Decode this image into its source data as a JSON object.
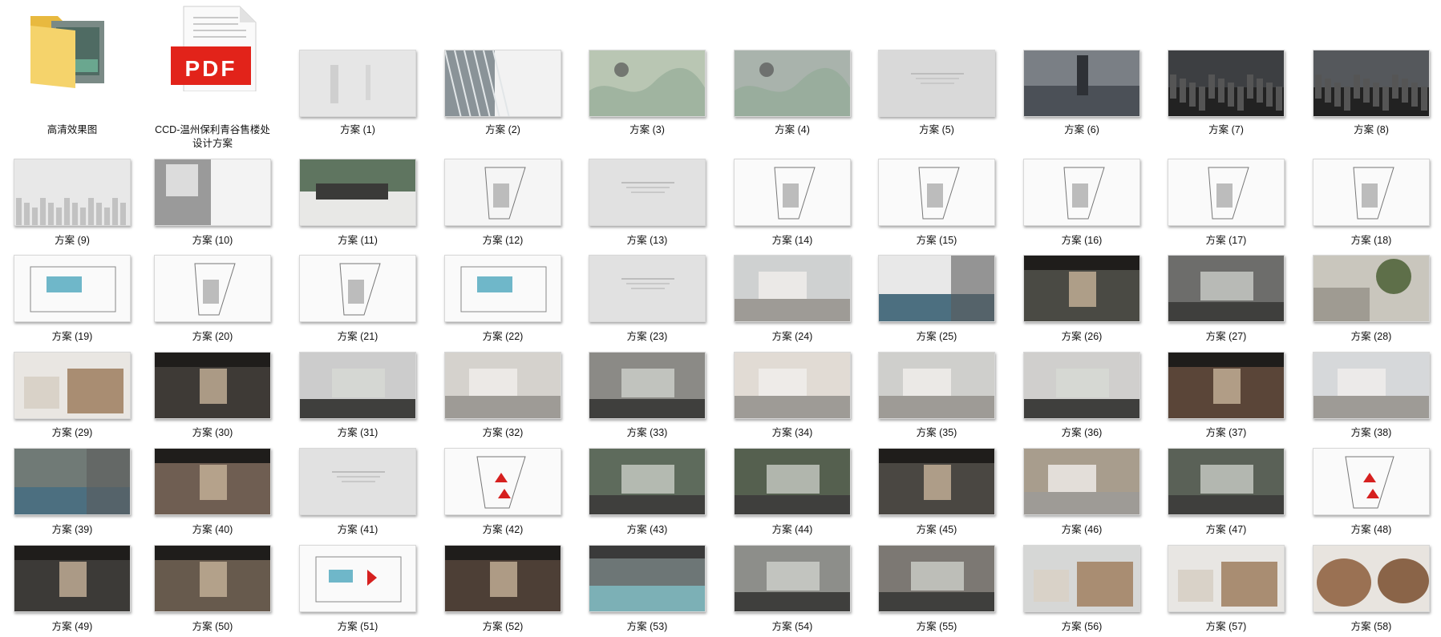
{
  "items": [
    {
      "label": "高清效果图",
      "kind": "folder",
      "thumb": "folder-icon"
    },
    {
      "label": "CCD-温州保利青谷售楼处设计方案",
      "kind": "pdf",
      "thumb": "pdf-icon",
      "badge": "PDF"
    },
    {
      "label": "方案 (1)",
      "thumb": {
        "bg": "#e6e6e6",
        "theme": "text-light"
      }
    },
    {
      "label": "方案 (2)",
      "thumb": {
        "bg": "#f2f2f2",
        "theme": "skylight"
      }
    },
    {
      "label": "方案 (3)",
      "thumb": {
        "bg": "#b9c6b3",
        "theme": "map"
      }
    },
    {
      "label": "方案 (4)",
      "thumb": {
        "bg": "#a9b3ac",
        "theme": "map"
      }
    },
    {
      "label": "方案 (5)",
      "thumb": {
        "bg": "#d9d9d9",
        "theme": "text-gray"
      }
    },
    {
      "label": "方案 (6)",
      "thumb": {
        "bg": "#7a7f85",
        "theme": "city-right"
      }
    },
    {
      "label": "方案 (7)",
      "thumb": {
        "bg": "#3d3f42",
        "theme": "city-dark"
      }
    },
    {
      "label": "方案 (8)",
      "thumb": {
        "bg": "#55585c",
        "theme": "city-dark"
      }
    },
    {
      "label": "方案 (9)",
      "thumb": {
        "bg": "#e8e8e8",
        "theme": "city-light"
      }
    },
    {
      "label": "方案 (10)",
      "thumb": {
        "bg": "#f3f3f3",
        "theme": "left-gray"
      }
    },
    {
      "label": "方案 (11)",
      "thumb": {
        "bg": "#5f7560",
        "theme": "landscape"
      }
    },
    {
      "label": "方案 (12)",
      "thumb": {
        "bg": "#f5f5f5",
        "theme": "plan-white"
      }
    },
    {
      "label": "方案 (13)",
      "thumb": {
        "bg": "#e1e1e1",
        "theme": "text-gray"
      }
    },
    {
      "label": "方案 (14)",
      "thumb": {
        "bg": "#fafafa",
        "theme": "plan-white"
      }
    },
    {
      "label": "方案 (15)",
      "thumb": {
        "bg": "#fafafa",
        "theme": "plan-white"
      }
    },
    {
      "label": "方案 (16)",
      "thumb": {
        "bg": "#fafafa",
        "theme": "plan-white"
      }
    },
    {
      "label": "方案 (17)",
      "thumb": {
        "bg": "#fafafa",
        "theme": "plan-white"
      }
    },
    {
      "label": "方案 (18)",
      "thumb": {
        "bg": "#fafafa",
        "theme": "plan-white"
      }
    },
    {
      "label": "方案 (19)",
      "thumb": {
        "bg": "#fafafa",
        "theme": "plan-pool"
      }
    },
    {
      "label": "方案 (20)",
      "thumb": {
        "bg": "#fafafa",
        "theme": "plan-white"
      }
    },
    {
      "label": "方案 (21)",
      "thumb": {
        "bg": "#fafafa",
        "theme": "plan-white"
      }
    },
    {
      "label": "方案 (22)",
      "thumb": {
        "bg": "#fafafa",
        "theme": "plan-pool"
      }
    },
    {
      "label": "方案 (23)",
      "thumb": {
        "bg": "#e1e1e1",
        "theme": "text-gray"
      }
    },
    {
      "label": "方案 (24)",
      "thumb": {
        "bg": "#cfd1d1",
        "theme": "interior-light"
      }
    },
    {
      "label": "方案 (25)",
      "thumb": {
        "bg": "#e8e8e8",
        "theme": "water"
      }
    },
    {
      "label": "方案 (26)",
      "thumb": {
        "bg": "#4a4a44",
        "theme": "interior-dark"
      }
    },
    {
      "label": "方案 (27)",
      "thumb": {
        "bg": "#6d6d6b",
        "theme": "interior-mid"
      }
    },
    {
      "label": "方案 (28)",
      "thumb": {
        "bg": "#c9c6bd",
        "theme": "tree"
      }
    },
    {
      "label": "方案 (29)",
      "thumb": {
        "bg": "#e9e6e2",
        "theme": "material"
      }
    },
    {
      "label": "方案 (30)",
      "thumb": {
        "bg": "#3e3a36",
        "theme": "interior-dark"
      }
    },
    {
      "label": "方案 (31)",
      "thumb": {
        "bg": "#cccccc",
        "theme": "interior-mid"
      }
    },
    {
      "label": "方案 (32)",
      "thumb": {
        "bg": "#d5d2cd",
        "theme": "interior-light"
      }
    },
    {
      "label": "方案 (33)",
      "thumb": {
        "bg": "#8b8a86",
        "theme": "interior-mid"
      }
    },
    {
      "label": "方案 (34)",
      "thumb": {
        "bg": "#e1dbd4",
        "theme": "interior-light"
      }
    },
    {
      "label": "方案 (35)",
      "thumb": {
        "bg": "#cfcfcc",
        "theme": "interior-light"
      }
    },
    {
      "label": "方案 (36)",
      "thumb": {
        "bg": "#d0cfcd",
        "theme": "interior-mid"
      }
    },
    {
      "label": "方案 (37)",
      "thumb": {
        "bg": "#5a4538",
        "theme": "interior-dark"
      }
    },
    {
      "label": "方案 (38)",
      "thumb": {
        "bg": "#d6d8da",
        "theme": "interior-light"
      }
    },
    {
      "label": "方案 (39)",
      "thumb": {
        "bg": "#707a76",
        "theme": "water"
      }
    },
    {
      "label": "方案 (40)",
      "thumb": {
        "bg": "#6f5e52",
        "theme": "interior-dark"
      }
    },
    {
      "label": "方案 (41)",
      "thumb": {
        "bg": "#e1e1e1",
        "theme": "text-gray"
      }
    },
    {
      "label": "方案 (42)",
      "thumb": {
        "bg": "#fafafa",
        "theme": "plan-red"
      }
    },
    {
      "label": "方案 (43)",
      "thumb": {
        "bg": "#5e6b5c",
        "theme": "interior-mid"
      }
    },
    {
      "label": "方案 (44)",
      "thumb": {
        "bg": "#55604f",
        "theme": "interior-mid"
      }
    },
    {
      "label": "方案 (45)",
      "thumb": {
        "bg": "#4a4742",
        "theme": "interior-dark"
      }
    },
    {
      "label": "方案 (46)",
      "thumb": {
        "bg": "#a89d8d",
        "theme": "interior-light"
      }
    },
    {
      "label": "方案 (47)",
      "thumb": {
        "bg": "#5a6157",
        "theme": "interior-mid"
      }
    },
    {
      "label": "方案 (48)",
      "thumb": {
        "bg": "#fafafa",
        "theme": "plan-red"
      }
    },
    {
      "label": "方案 (49)",
      "thumb": {
        "bg": "#3c3a37",
        "theme": "interior-dark"
      }
    },
    {
      "label": "方案 (50)",
      "thumb": {
        "bg": "#675a4d",
        "theme": "interior-dark"
      }
    },
    {
      "label": "方案 (51)",
      "thumb": {
        "bg": "#fafafa",
        "theme": "plan-pool-red"
      }
    },
    {
      "label": "方案 (52)",
      "thumb": {
        "bg": "#4d3f36",
        "theme": "interior-dark"
      }
    },
    {
      "label": "方案 (53)",
      "thumb": {
        "bg": "#6d7676",
        "theme": "pool-interior"
      }
    },
    {
      "label": "方案 (54)",
      "thumb": {
        "bg": "#8d8e8a",
        "theme": "interior-mid"
      }
    },
    {
      "label": "方案 (55)",
      "thumb": {
        "bg": "#7c7873",
        "theme": "interior-mid"
      }
    },
    {
      "label": "方案 (56)",
      "thumb": {
        "bg": "#d6d7d6",
        "theme": "material"
      }
    },
    {
      "label": "方案 (57)",
      "thumb": {
        "bg": "#e8e6e3",
        "theme": "material"
      }
    },
    {
      "label": "方案 (58)",
      "thumb": {
        "bg": "#e8e4df",
        "theme": "wood"
      }
    }
  ],
  "colors": {
    "folder_yellow": "#f5d36b",
    "folder_dark": "#e8b93f",
    "pdf_red": "#e2231a",
    "label_text": "#111111",
    "plan_red": "#d6201f",
    "pool_blue": "#6fb7c9"
  }
}
